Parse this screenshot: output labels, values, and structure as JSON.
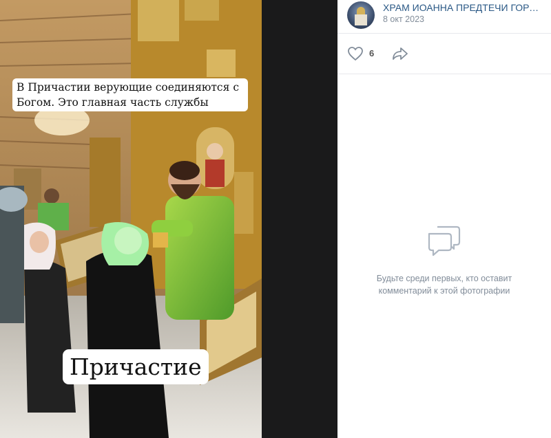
{
  "post": {
    "author": "ХРАМ ИОАННА ПРЕДТЕЧИ ГОРОД ...",
    "date": "8 окт 2023",
    "likes": "6"
  },
  "photo": {
    "caption_top": "В Причастии верующие соединяются с Богом.    Это главная часть службы",
    "caption_bottom": "Причастие"
  },
  "comments": {
    "empty_text": "Будьте среди первых, кто оставит комментарий к этой фотографии"
  },
  "icons": {
    "like": "heart-icon",
    "share": "share-arrow-icon",
    "empty": "comment-bubbles-icon"
  },
  "colors": {
    "link": "#2a5885",
    "muted": "#818c99"
  }
}
